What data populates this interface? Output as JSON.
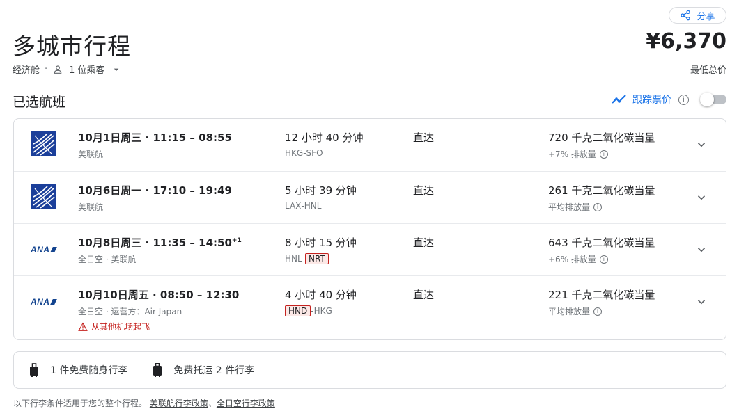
{
  "header": {
    "share_label": "分享",
    "title": "多城市行程",
    "cabin": "经济舱",
    "passengers": "1 位乘客",
    "price": "¥6,370",
    "price_label": "最低总价"
  },
  "section": {
    "title": "已选航班",
    "track_label": "跟踪票价"
  },
  "flights": [
    {
      "airline_logo": "united-logo",
      "when": "10月1日周三 · 11:15 – 08:55",
      "plus_days": "",
      "airline": "美联航",
      "warning": "",
      "duration": "12 小时 40 分钟",
      "route_from": "HKG",
      "route_sep": "-",
      "route_to": "SFO",
      "stops": "直达",
      "emissions": "720 千克二氧化碳当量",
      "emissions_sub": "+7% 排放量"
    },
    {
      "airline_logo": "united-logo",
      "when": "10月6日周一 · 17:10 – 19:49",
      "plus_days": "",
      "airline": "美联航",
      "warning": "",
      "duration": "5 小时 39 分钟",
      "route_from": "LAX",
      "route_sep": "-",
      "route_to": "HNL",
      "stops": "直达",
      "emissions": "261 千克二氧化碳当量",
      "emissions_sub": "平均排放量"
    },
    {
      "airline_logo": "ana-logo",
      "when": "10月8日周三 · 11:35 – 14:50",
      "plus_days": "+1",
      "airline": "全日空 · 美联航",
      "warning": "",
      "duration": "8 小时 15 分钟",
      "route_from": "HNL",
      "route_sep": "-",
      "route_to": "NRT",
      "stops": "直达",
      "emissions": "643 千克二氧化碳当量",
      "emissions_sub": "+6% 排放量"
    },
    {
      "airline_logo": "ana-logo",
      "when": "10月10日周五 · 08:50 – 12:30",
      "plus_days": "",
      "airline": "全日空 · 运营方：Air Japan",
      "warning": "从其他机场起飞",
      "duration": "4 小时 40 分钟",
      "route_from": "HND",
      "route_sep": "-",
      "route_to": "HKG",
      "stops": "直达",
      "emissions": "221 千克二氧化碳当量",
      "emissions_sub": "平均排放量"
    }
  ],
  "ana_text": "ANA",
  "baggage": {
    "carry_on": "1 件免费随身行李",
    "checked": "免费托运 2 件行李"
  },
  "footer": {
    "text": "以下行李条件适用于您的整个行程。",
    "link1": "美联航行李政策",
    "sep": "、",
    "link2": "全日空行李政策"
  },
  "colors": {
    "accent": "#1a73e8",
    "warning": "#c5221f",
    "united": "#1b3f9a",
    "ana": "#13448f"
  }
}
